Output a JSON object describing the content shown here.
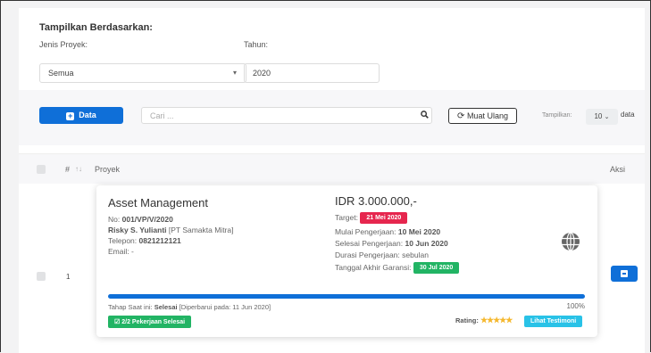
{
  "filter": {
    "heading": "Tampilkan Berdasarkan:",
    "jenis_label": "Jenis Proyek:",
    "jenis_value": "Semua",
    "tahun_label": "Tahun:",
    "tahun_value": "2020"
  },
  "toolbar": {
    "data_button": "Data",
    "search_placeholder": "Cari ...",
    "reload_button": "Muat Ulang",
    "show_label": "Tampilkan:",
    "page_size": "10",
    "data_suffix": "data"
  },
  "table": {
    "col_number": "#",
    "col_project": "Proyek",
    "col_action": "Aksi"
  },
  "row": {
    "number": "1",
    "title": "Asset Management",
    "no_label": "No:",
    "no_value": "001/VP/V/2020",
    "client_name": "Risky S. Yulianti",
    "client_company": "[PT Samakta Mitra]",
    "phone_label": "Telepon:",
    "phone_value": "0821212121",
    "email_label": "Email:",
    "email_value": "-",
    "price": "IDR 3.000.000,-",
    "target_label": "Target:",
    "target_value": "21 Mei 2020",
    "start_label": "Mulai Pengerjaan:",
    "start_value": "10 Mei 2020",
    "end_label": "Selesai Pengerjaan:",
    "end_value": "10 Jun 2020",
    "duration_label": "Durasi Pengerjaan:",
    "duration_value": "sebulan",
    "warranty_label": "Tanggal Akhir Garansi:",
    "warranty_value": "30 Jul 2020",
    "stage_label": "Tahap Saat ini:",
    "stage_value": "Selesai",
    "stage_updated": "[Diperbarui pada: 11 Jun 2020]",
    "progress_text": "100%",
    "progress_value": 100,
    "tasks_badge": "2/2 Pekerjaan Selesai",
    "rating_label": "Rating:",
    "rating_stars": "★★★★★",
    "rating_value": 5,
    "testimony_button": "Lihat Testimoni"
  },
  "colors": {
    "primary": "#0f6fd8",
    "danger": "#e6264e",
    "success": "#22b464",
    "info": "#29c2e7",
    "star": "#f5b82e"
  },
  "icons": {
    "search": "search-icon",
    "reload": "refresh-icon",
    "globe": "globe-icon",
    "add": "plus-square-icon",
    "action": "action-icon"
  }
}
